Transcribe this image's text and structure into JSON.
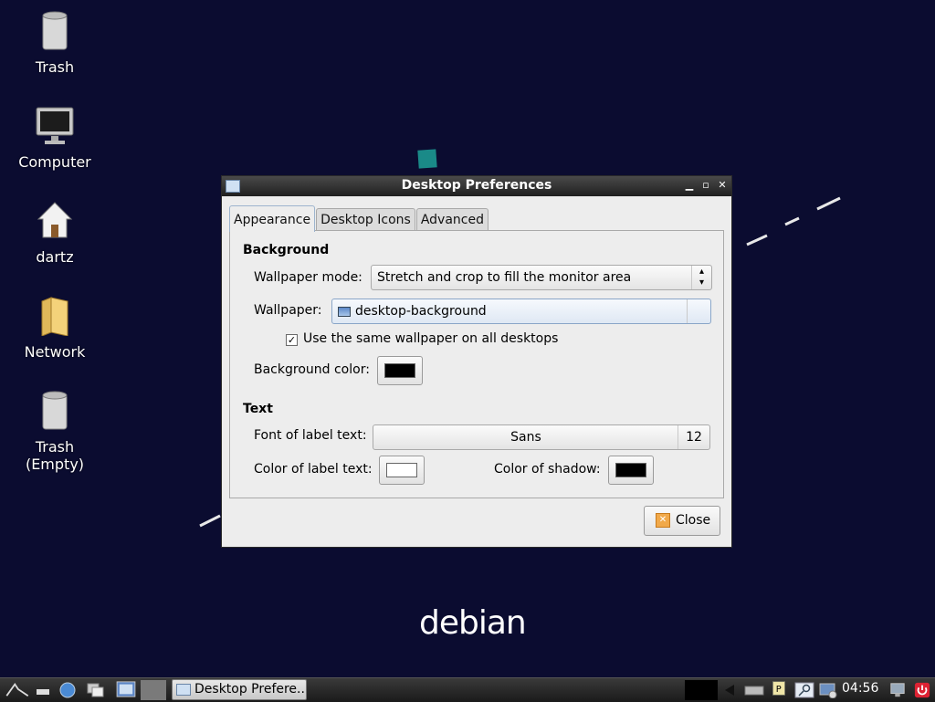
{
  "desktop": {
    "icons": [
      {
        "label": "Trash",
        "icon": "trash-icon"
      },
      {
        "label": "Computer",
        "icon": "computer-icon"
      },
      {
        "label": "dartz",
        "icon": "home-icon"
      },
      {
        "label": "Network",
        "icon": "network-icon"
      },
      {
        "label": "Trash\n(Empty)",
        "label_line1": "Trash",
        "label_line2": "(Empty)",
        "icon": "trash-icon"
      }
    ],
    "wallpaper_logo": "debian",
    "background_color": "#0b0c30"
  },
  "window": {
    "title": "Desktop Preferences",
    "tabs": [
      {
        "label": "Appearance",
        "active": true
      },
      {
        "label": "Desktop Icons",
        "active": false
      },
      {
        "label": "Advanced",
        "active": false
      }
    ],
    "background_section": {
      "heading": "Background",
      "wallpaper_mode_label": "Wallpaper mode:",
      "wallpaper_mode_value": "Stretch and crop to fill the monitor area",
      "wallpaper_label": "Wallpaper:",
      "wallpaper_value": "desktop-background",
      "same_wallpaper_label": "Use the same wallpaper on all desktops",
      "same_wallpaper_checked": true,
      "background_color_label": "Background color:",
      "background_color": "#000000"
    },
    "text_section": {
      "heading": "Text",
      "font_label": "Font of label text:",
      "font_name": "Sans",
      "font_size": "12",
      "label_color_label": "Color of label text:",
      "label_color": "#ffffff",
      "shadow_color_label": "Color of shadow:",
      "shadow_color": "#000000"
    },
    "close_label": "Close"
  },
  "taskbar": {
    "task_label": "Desktop Prefere...",
    "clock": "04:56"
  }
}
